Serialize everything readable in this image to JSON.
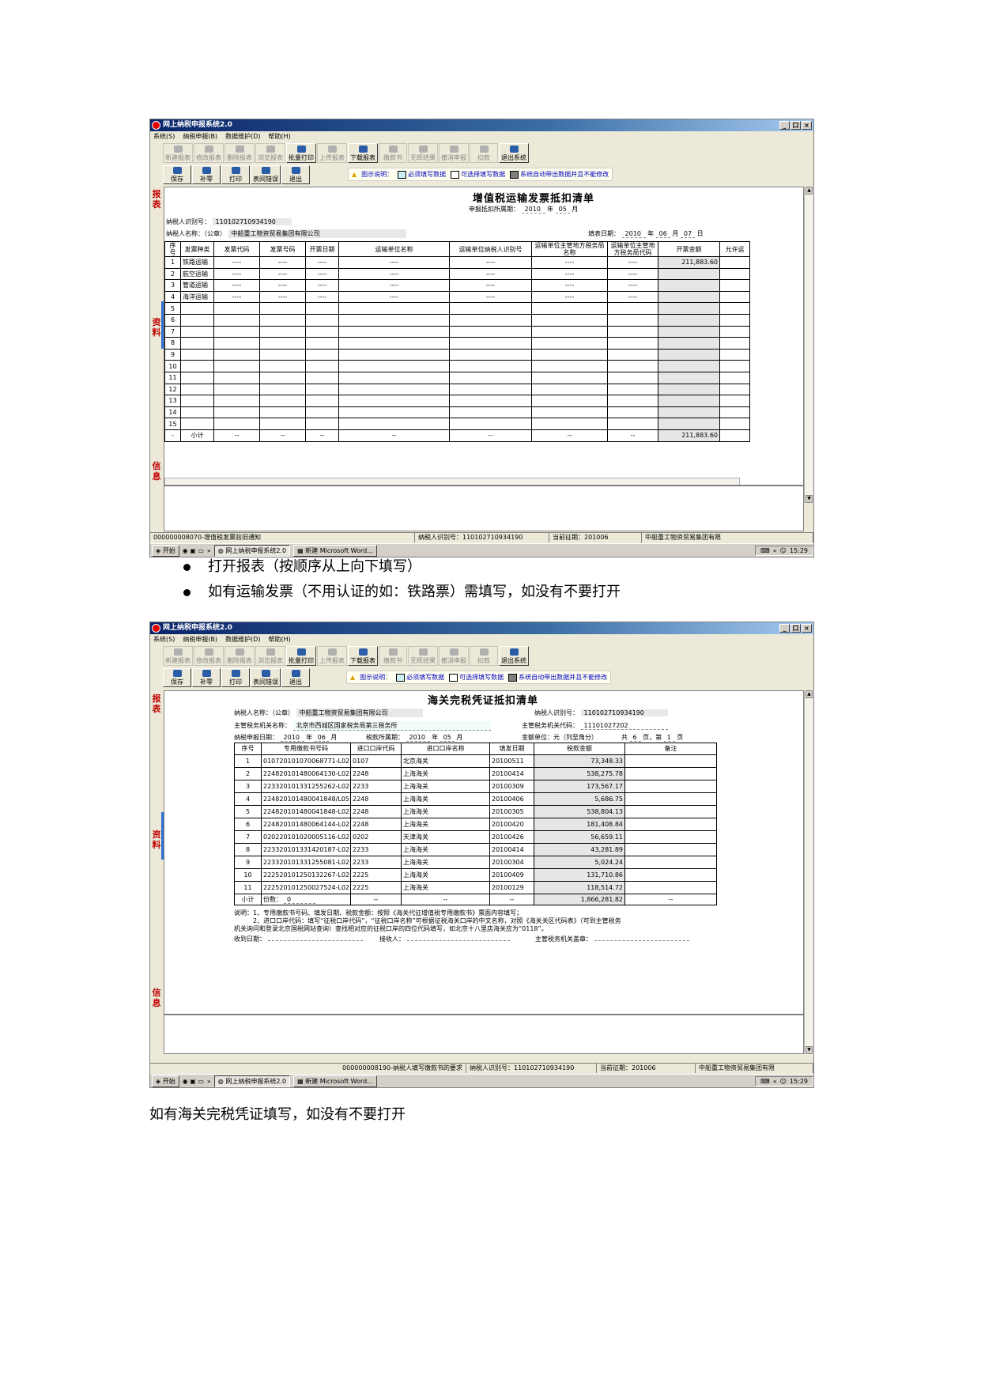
{
  "app": {
    "title": "网上纳税申报系统2.0",
    "win_buttons": [
      "_",
      "口",
      "×"
    ],
    "menu": [
      "系统(S)",
      "纳税申报(B)",
      "数据维护(D)",
      "帮助(H)"
    ],
    "toolbar1": [
      "新建报表",
      "修改报表",
      "删除报表",
      "浏览报表",
      "批量打印",
      "上传报表",
      "下载报表",
      "缴款书",
      "无辉结果",
      "撤消申报",
      "扣款",
      "退出系统"
    ],
    "toolbar1_active": [
      false,
      false,
      false,
      false,
      true,
      false,
      true,
      false,
      false,
      false,
      false,
      true
    ],
    "toolbar2": [
      "保存",
      "补零",
      "打印",
      "表间错误",
      "退出"
    ],
    "legend": {
      "prefix": "图示说明：",
      "required": "必须填写数据",
      "optional": "可选择填写数据",
      "system": "系统自动带出数据并且不能修改"
    },
    "side": {
      "report": "报表",
      "info": "资料",
      "msg": "信息"
    },
    "colors": {
      "required": "#cdeef0",
      "optional": "#ffffff",
      "system": "#808080"
    }
  },
  "screen1": {
    "doc_title": "增值税运输发票抵扣清单",
    "period_label": "申报抵扣所属期：",
    "period_year": "2010",
    "period_month": "05",
    "year_unit": "年",
    "month_unit": "月",
    "day_unit": "日",
    "taxpayer_id_label": "纳税人识别号：",
    "taxpayer_id": "110102710934190",
    "taxpayer_name_label": "纳税人名称：（公章）",
    "taxpayer_name": "中船重工物资贸易集团有限公司",
    "fill_date_label": "填表日期：",
    "fill_year": "2010",
    "fill_month": "06",
    "fill_day": "07",
    "headers": [
      "序号",
      "发票种类",
      "发票代码",
      "发票号码",
      "开票日期",
      "运输单位名称",
      "运输单位纳税人识别号",
      "运输单位主管地方税务局名称",
      "运输单位主管地方税务局代码",
      "开票金额",
      "允许运"
    ],
    "rows": [
      [
        "1",
        "铁路运输",
        "----",
        "----",
        "----",
        "----",
        "----",
        "----",
        "----",
        "211,883.60"
      ],
      [
        "2",
        "航空运输",
        "----",
        "----",
        "----",
        "----",
        "----",
        "----",
        "----",
        ""
      ],
      [
        "3",
        "管道运输",
        "----",
        "----",
        "----",
        "----",
        "----",
        "----",
        "----",
        ""
      ],
      [
        "4",
        "海洋运输",
        "----",
        "----",
        "----",
        "----",
        "----",
        "----",
        "----",
        ""
      ],
      [
        "5",
        "",
        "",
        "",
        "",
        "",
        "",
        "",
        "",
        ""
      ],
      [
        "6",
        "",
        "",
        "",
        "",
        "",
        "",
        "",
        "",
        ""
      ],
      [
        "7",
        "",
        "",
        "",
        "",
        "",
        "",
        "",
        "",
        ""
      ],
      [
        "8",
        "",
        "",
        "",
        "",
        "",
        "",
        "",
        "",
        ""
      ],
      [
        "9",
        "",
        "",
        "",
        "",
        "",
        "",
        "",
        "",
        ""
      ],
      [
        "10",
        "",
        "",
        "",
        "",
        "",
        "",
        "",
        "",
        ""
      ],
      [
        "11",
        "",
        "",
        "",
        "",
        "",
        "",
        "",
        "",
        ""
      ],
      [
        "12",
        "",
        "",
        "",
        "",
        "",
        "",
        "",
        "",
        ""
      ],
      [
        "13",
        "",
        "",
        "",
        "",
        "",
        "",
        "",
        "",
        ""
      ],
      [
        "14",
        "",
        "",
        "",
        "",
        "",
        "",
        "",
        "",
        ""
      ],
      [
        "15",
        "",
        "",
        "",
        "",
        "",
        "",
        "",
        "",
        ""
      ]
    ],
    "total_row": [
      "-",
      "小计",
      "--",
      "--",
      "--",
      "--",
      "--",
      "--",
      "--",
      "211,883.60"
    ],
    "status": [
      "000000008070-增值税发票验旧通知",
      "纳税人识别号：110102710934190",
      "当前征期：201006",
      "中船重工物资贸易集团有限"
    ]
  },
  "screen2": {
    "doc_title": "海关完税凭证抵扣清单",
    "taxpayer_name_label": "纳税人名称：（公章）",
    "taxpayer_name": "中船重工物资贸易集团有限公司",
    "taxpayer_id_label": "纳税人识别号：",
    "taxpayer_id": "110102710934190",
    "bureau_label": "主管税务机关名称：",
    "bureau": "北京市西城区国家税务局第三税务所",
    "bureau_code_label": "主管税务机关代码：",
    "bureau_code": "11101027202",
    "period_label": "纳税申报日期：",
    "period_year": "2010",
    "period_month": "06",
    "tax_period_label": "税款所属期：",
    "tax_year": "2010",
    "tax_month": "05",
    "year_unit": "年",
    "month_unit": "月",
    "unit_label": "金额单位：元（列至角分）",
    "pages_label_a": "共",
    "pages_total": "6",
    "pages_label_b": "页，第",
    "page_no": "1",
    "pages_label_c": "页",
    "headers": [
      "序号",
      "专用缴款书号码",
      "进口口岸代码",
      "进口口岸名称",
      "填发日期",
      "税款金额",
      "备注"
    ],
    "rows": [
      [
        "1",
        "010720101070068771-L02",
        "0107",
        "北京海关",
        "20100511",
        "73,348.33",
        ""
      ],
      [
        "2",
        "224820101480064130-L02",
        "2248",
        "上海海关",
        "20100414",
        "538,275.78",
        ""
      ],
      [
        "3",
        "223320101331255262-L02",
        "2233",
        "上海海关",
        "20100309",
        "173,567.17",
        ""
      ],
      [
        "4",
        "224820101480041848/L05",
        "2248",
        "上海海关",
        "20100406",
        "5,686.75",
        ""
      ],
      [
        "5",
        "224820101480041848-L02",
        "2248",
        "上海海关",
        "20100305",
        "538,804.13",
        ""
      ],
      [
        "6",
        "224820101480064144-L02",
        "2248",
        "上海海关",
        "20100420",
        "181,408.84",
        ""
      ],
      [
        "7",
        "020220101020005116-L02",
        "0202",
        "天津海关",
        "20100426",
        "56,659.11",
        ""
      ],
      [
        "8",
        "223320101331420187-L02",
        "2233",
        "上海海关",
        "20100414",
        "43,281.89",
        ""
      ],
      [
        "9",
        "223320101331255081-L02",
        "2233",
        "上海海关",
        "20100304",
        "5,024.24",
        ""
      ],
      [
        "10",
        "222520101250132267-L02",
        "2225",
        "上海海关",
        "20100409",
        "131,710.86",
        ""
      ],
      [
        "11",
        "222520101250027524-L02",
        "2225",
        "上海海关",
        "20100129",
        "118,514.72",
        ""
      ]
    ],
    "total_row": [
      "小计",
      "份数：",
      "0",
      "--",
      "--",
      "--",
      "1,866,281.82",
      "--"
    ],
    "notes": [
      "说明：1、专用缴款书号码、填发日期、税款金额：按照《海关代征增值税专用缴款书》票面内容填写；",
      "2、进口口岸代码：填写“征税口岸代码”，“征税口岸名称”可根据征税海关口岸的中文名称，对照《海关关区代码表》（可到主管税务",
      "机关询问和登录北京国税网站查询）查找相对应的征税口岸的四位代码填写，如北京十八里店海关应为“0118”。"
    ],
    "receive_label": "收到日期：",
    "receiver_label": "接收人：",
    "seal_label": "主管税务机关盖章：",
    "status": [
      "000000008190-纳税人填写缴款书的要求",
      "纳税人识别号：110102710934190",
      "当前征期：201006",
      "中船重工物资贸易集团有限"
    ]
  },
  "taskbar": {
    "start": "开始",
    "arrows": "»",
    "task1": "网上纳税申报系统2.0",
    "task2": "新建 Microsoft Word...",
    "tray_arrows": "«",
    "time": "15:29"
  },
  "text": {
    "bullet1": "打开报表（按顺序从上向下填写）",
    "bullet2": "如有运输发票（不用认证的如：铁路票）需填写，如没有不要打开",
    "para": "如有海关完税凭证填写，如没有不要打开"
  }
}
